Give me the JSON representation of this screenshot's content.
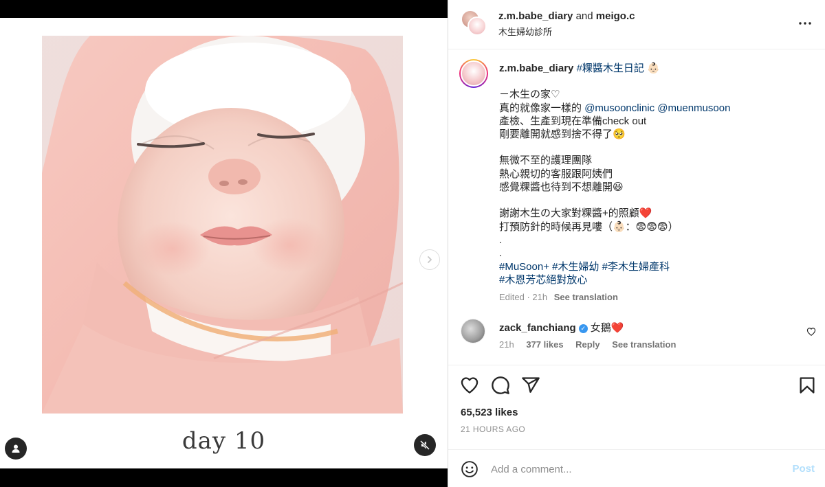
{
  "post": {
    "authors": {
      "primary": "z.m.babe_diary",
      "joiner": "and",
      "secondary": "meigo.c"
    },
    "location": "木生婦幼診所",
    "media": {
      "overlay_text": "day 10"
    }
  },
  "caption": {
    "username": "z.m.babe_diary",
    "hashtag_title": "#粿醬木生日記",
    "title_emoji": "👶🏻",
    "line1": "－木生の家♡",
    "line2_prefix": "真的就像家一樣的",
    "mention1": "@musoonclinic",
    "mention2": "@muenmusoon",
    "line3": "產檢、生產到現在準備check out",
    "line4": "剛要離開就感到捨不得了🥺",
    "line5": "無微不至的護理團隊",
    "line6": "熱心親切的客服跟阿姨們",
    "line7": "感覺粿醬也待到不想離開😆",
    "line8": "謝謝木生の大家對粿醬+的照顧❤️",
    "line9": "打預防針的時候再見嘍（👶🏻：😨😨😨）",
    "dot1": ".",
    "dot2": ".",
    "tags_line1": [
      "#MuSoon+",
      "#木生婦幼",
      "#李木生婦產科"
    ],
    "tags_line2": "#木恩芳芯絕對放心",
    "edited": "Edited · 21h",
    "see_translation": "See translation"
  },
  "comment": {
    "username": "zack_fanchiang",
    "verified_mark": "✓",
    "text": "女鵝❤️",
    "time": "21h",
    "likes": "377 likes",
    "reply": "Reply",
    "see_translation": "See translation"
  },
  "stats": {
    "likes": "65,523 likes",
    "posted": "21 HOURS AGO"
  },
  "add_comment": {
    "placeholder": "Add a comment...",
    "post_label": "Post"
  },
  "colors": {
    "link": "#00376b",
    "verified": "#3897f0",
    "post_disabled": "#b2dffc"
  }
}
